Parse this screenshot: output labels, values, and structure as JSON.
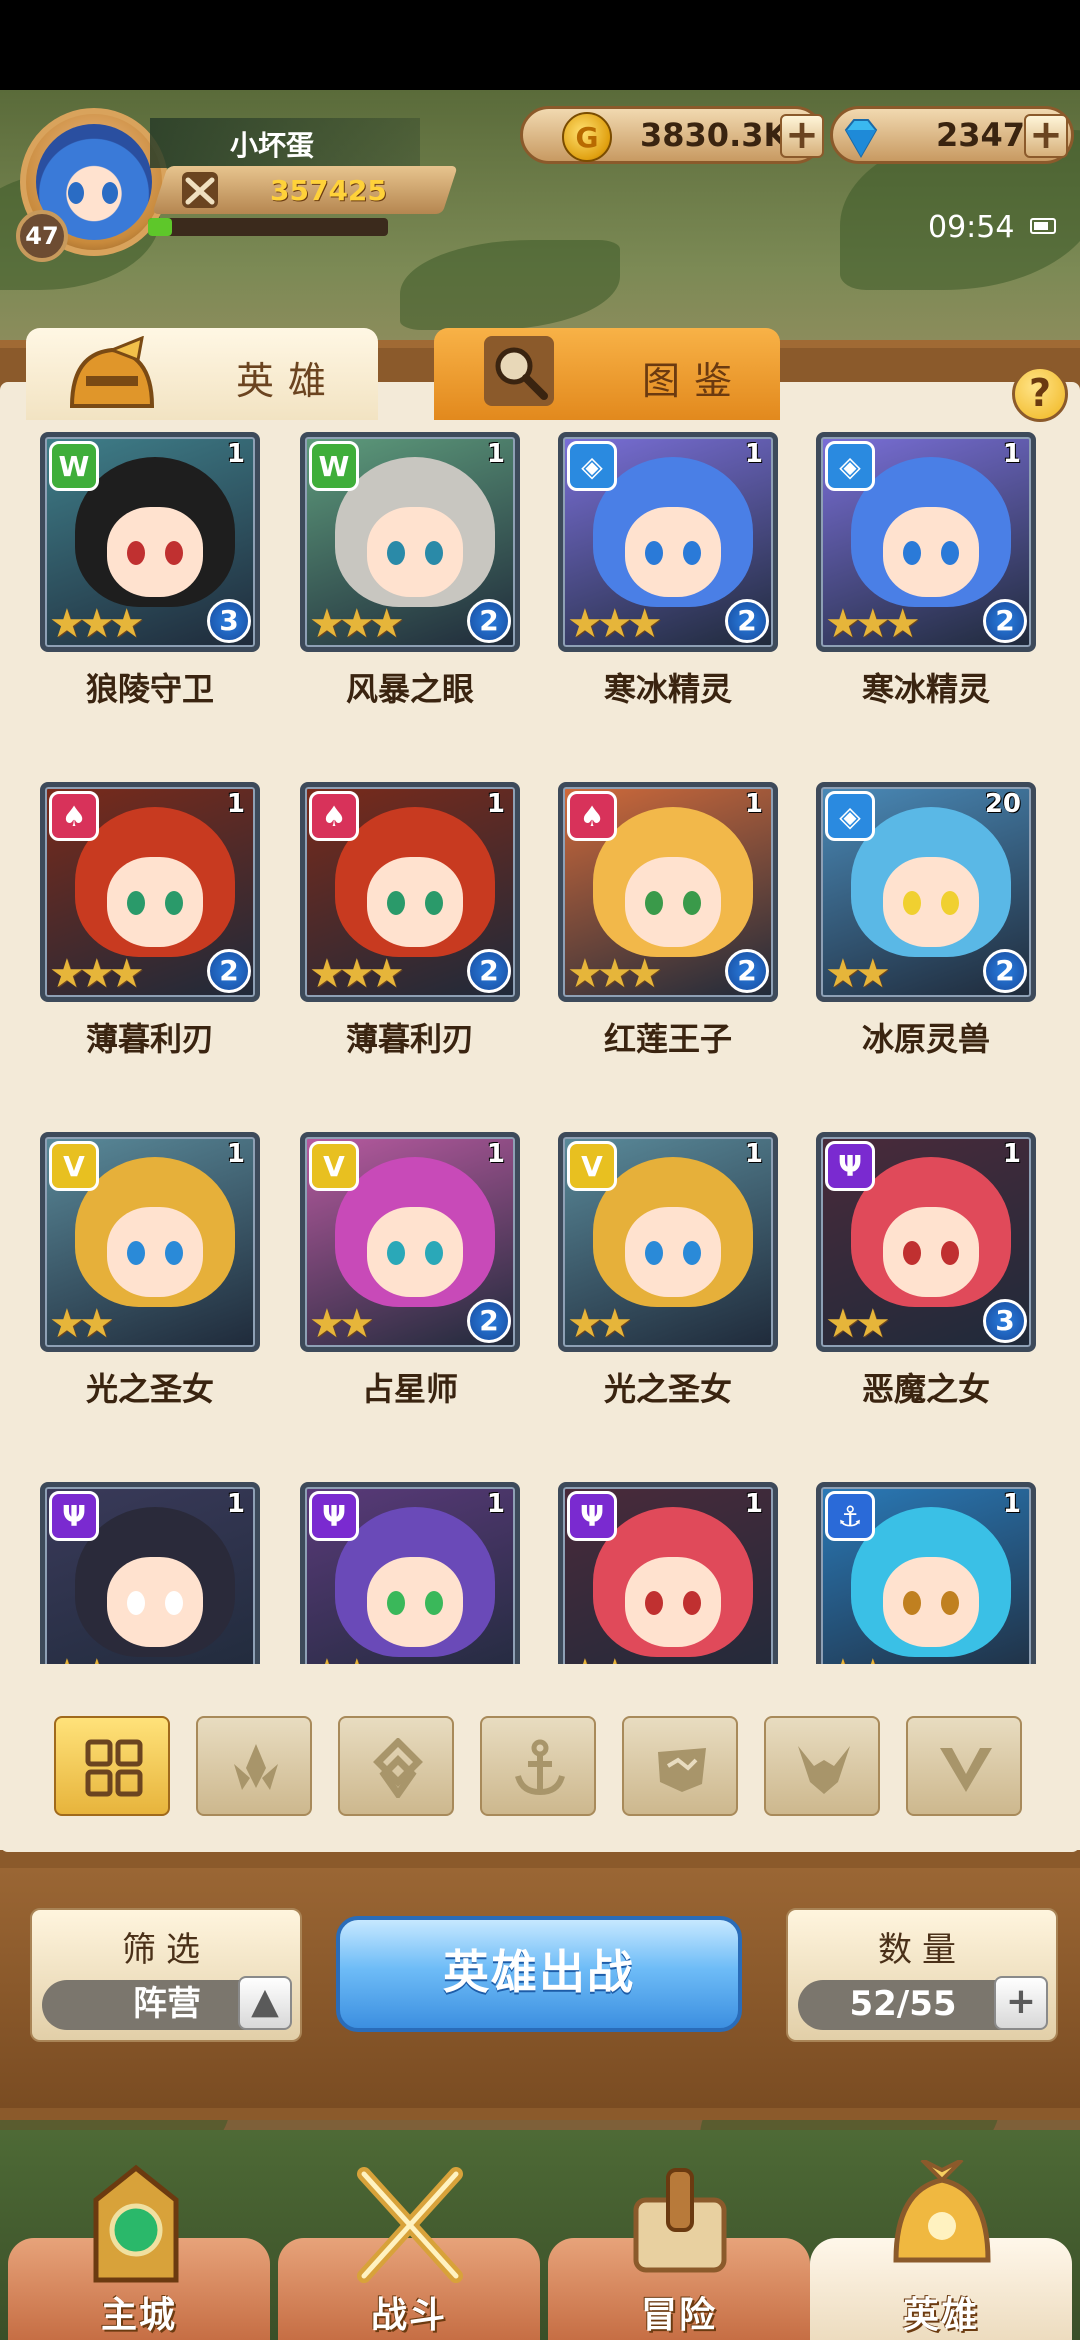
{
  "player": {
    "name": "小坏蛋",
    "level": "47",
    "power": "357425",
    "exp_fraction": 0.1
  },
  "resources": {
    "gold": "3830.3K",
    "gems": "2347"
  },
  "status": {
    "time": "09:54"
  },
  "tabs": [
    {
      "label": "英雄"
    },
    {
      "label": "图鉴"
    }
  ],
  "help_label": "?",
  "heroes": [
    {
      "name": "狼陵守卫",
      "level": "1",
      "rank": "3",
      "stars": "★★★",
      "faction": "beast",
      "hair": "#1e1e1e",
      "bg": "#3f7f8a",
      "eye": "#c03030"
    },
    {
      "name": "风暴之眼",
      "level": "1",
      "rank": "2",
      "stars": "★★★",
      "faction": "beast",
      "hair": "#c8c6c0",
      "bg": "#5e9c7c",
      "eye": "#2a8aa8"
    },
    {
      "name": "寒冰精灵",
      "level": "1",
      "rank": "2",
      "stars": "★★★",
      "faction": "ice",
      "hair": "#4a7fe6",
      "bg": "#7a6fd8",
      "eye": "#2a7ad8"
    },
    {
      "name": "寒冰精灵",
      "level": "1",
      "rank": "2",
      "stars": "★★★",
      "faction": "ice",
      "hair": "#4a7fe6",
      "bg": "#7a6fd8",
      "eye": "#2a7ad8"
    },
    {
      "name": "薄暮利刃",
      "level": "1",
      "rank": "2",
      "stars": "★★★",
      "faction": "fire",
      "hair": "#c83a20",
      "bg": "#7a2a1a",
      "eye": "#2a9a6a"
    },
    {
      "name": "薄暮利刃",
      "level": "1",
      "rank": "2",
      "stars": "★★★",
      "faction": "fire",
      "hair": "#c83a20",
      "bg": "#7a2a1a",
      "eye": "#2a9a6a"
    },
    {
      "name": "红莲王子",
      "level": "1",
      "rank": "2",
      "stars": "★★★",
      "faction": "fire",
      "hair": "#f2b84a",
      "bg": "#d06a3a",
      "eye": "#3a9a4a"
    },
    {
      "name": "冰原灵兽",
      "level": "20",
      "rank": "2",
      "stars": "★★",
      "faction": "ice",
      "hair": "#5ab8e6",
      "bg": "#4a8ab8",
      "eye": "#f0d030"
    },
    {
      "name": "光之圣女",
      "level": "1",
      "rank": "",
      "stars": "★★",
      "faction": "light",
      "hair": "#e6b03a",
      "bg": "#5a8a9a",
      "eye": "#2a8ad8"
    },
    {
      "name": "占星师",
      "level": "1",
      "rank": "2",
      "stars": "★★",
      "faction": "light",
      "hair": "#c84ab8",
      "bg": "#b85aa0",
      "eye": "#2aa8b8"
    },
    {
      "name": "光之圣女",
      "level": "1",
      "rank": "",
      "stars": "★★",
      "faction": "light",
      "hair": "#e6b03a",
      "bg": "#5a8a9a",
      "eye": "#2a8ad8"
    },
    {
      "name": "恶魔之女",
      "level": "1",
      "rank": "3",
      "stars": "★★",
      "faction": "dark",
      "hair": "#e04a5a",
      "bg": "#4a2a3a",
      "eye": "#c03030"
    },
    {
      "name": "",
      "level": "1",
      "rank": "",
      "stars": "★★",
      "faction": "dark",
      "hair": "#2a2a3a",
      "bg": "#3a3a5a",
      "eye": "#ffffff"
    },
    {
      "name": "",
      "level": "1",
      "rank": "",
      "stars": "★★",
      "faction": "dark",
      "hair": "#6a4ab8",
      "bg": "#5a3a7a",
      "eye": "#3ab85a"
    },
    {
      "name": "",
      "level": "1",
      "rank": "",
      "stars": "★★",
      "faction": "dark",
      "hair": "#e04a5a",
      "bg": "#4a2a3a",
      "eye": "#c03030"
    },
    {
      "name": "",
      "level": "1",
      "rank": "",
      "stars": "★★",
      "faction": "ocean",
      "hair": "#3ac0e6",
      "bg": "#2a7ab8",
      "eye": "#c08020"
    }
  ],
  "faction_colors": {
    "beast": "#3fae3a",
    "ice": "#2a8ae0",
    "fire": "#d8325a",
    "light": "#e8c020",
    "dark": "#7a2ad0",
    "ocean": "#2a6ad8"
  },
  "filter_buttons": [
    "all-grid-icon",
    "fire-icon",
    "ice-icon",
    "anchor-icon",
    "beast-icon",
    "dark-icon",
    "light-icon"
  ],
  "controls": {
    "filter_title": "筛选",
    "filter_value": "阵营",
    "filter_toggle": "▲",
    "deploy_label": "英雄出战",
    "count_title": "数量",
    "count_value": "52/55",
    "count_add": "+"
  },
  "nav": [
    {
      "label": "主城"
    },
    {
      "label": "战斗"
    },
    {
      "label": "冒险"
    },
    {
      "label": "英雄"
    }
  ]
}
